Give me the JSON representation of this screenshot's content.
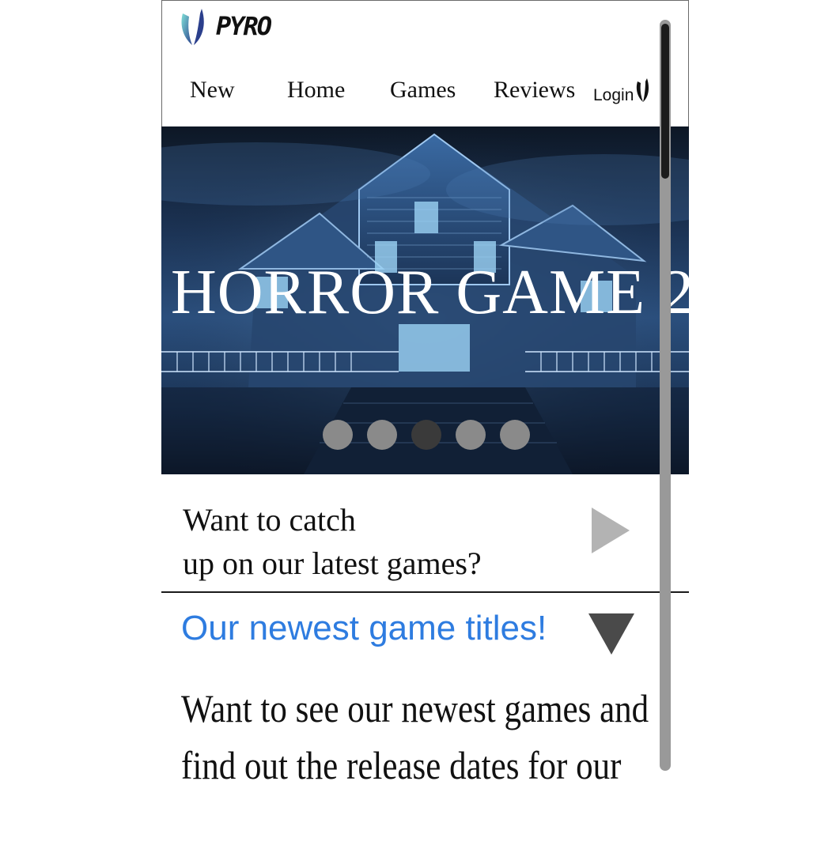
{
  "brand": {
    "name": "PYRO",
    "logo_icon": "flame-logo-icon"
  },
  "nav": {
    "items": [
      {
        "label": "New"
      },
      {
        "label": "Home"
      },
      {
        "label": "Games"
      },
      {
        "label": "Reviews"
      }
    ],
    "login_label": "Login",
    "login_icon": "flame-icon"
  },
  "hero": {
    "title": "HORROR GAME 2",
    "image_description_icon": "haunted-house-image",
    "carousel": {
      "total": 5,
      "active_index": 2
    }
  },
  "catch_up": {
    "line1": "Want to catch",
    "line2": "up on our latest games?",
    "icon": "play-arrow-icon"
  },
  "newest": {
    "title": "Our newest game titles!",
    "icon": "collapse-arrow-icon",
    "body_line1": "Want to see our newest games and",
    "body_line2": "find out the release dates for our"
  },
  "colors": {
    "accent_blue": "#2e7ce0",
    "arrow_gray": "#b3b3b3",
    "arrow_dark": "#4a4a4a",
    "dot": "#8a8a8a",
    "dot_active": "#3a3a3a"
  }
}
